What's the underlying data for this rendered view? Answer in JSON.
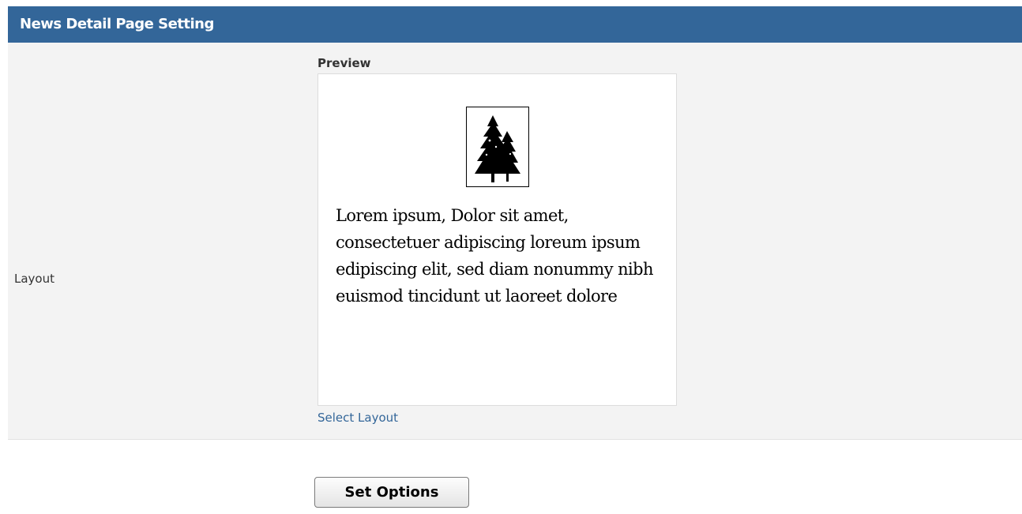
{
  "header": {
    "title": "News Detail Page Setting"
  },
  "layout_row": {
    "label": "Layout",
    "preview_title": "Preview",
    "preview_image_icon": "pine-trees-icon",
    "preview_text": "Lorem ipsum, Dolor sit amet, consectetuer adipiscing loreum ipsum edipiscing elit, sed diam nonummy nibh euismod tincidunt ut laoreet dolore",
    "select_layout_label": "Select Layout"
  },
  "actions": {
    "set_options_label": "Set Options"
  },
  "colors": {
    "header_bg": "#336699",
    "row_bg": "#f3f3f3",
    "link": "#336699"
  }
}
